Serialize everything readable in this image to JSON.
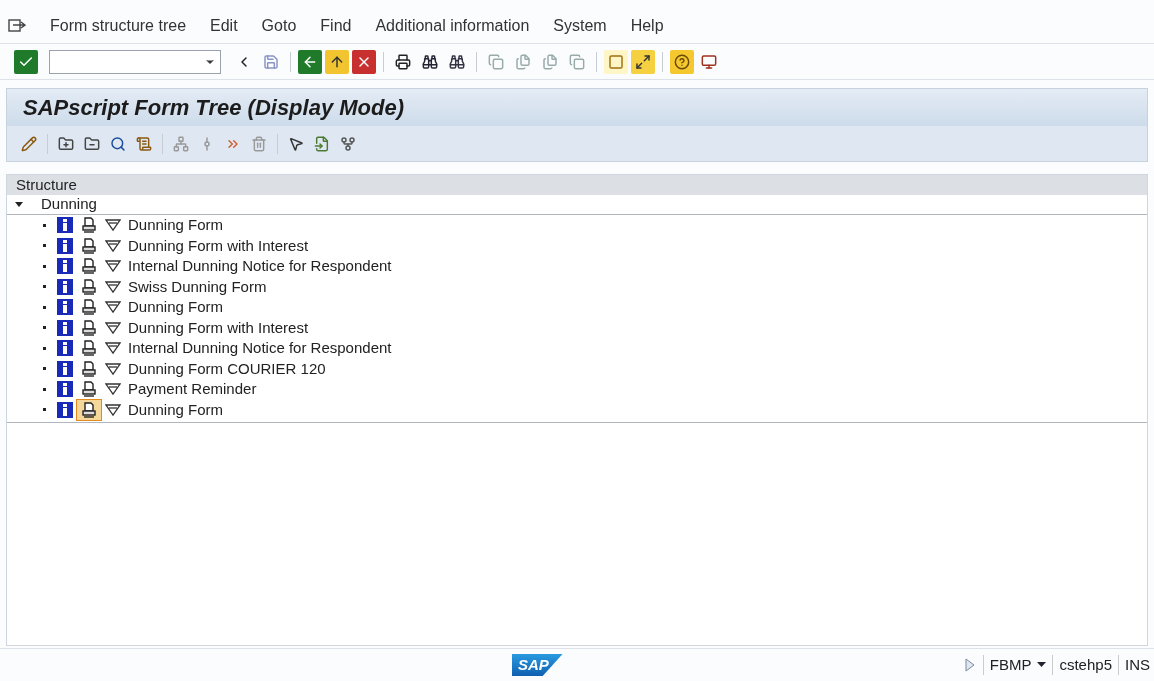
{
  "menu_bar": {
    "items": [
      "Form structure tree",
      "Edit",
      "Goto",
      "Find",
      "Additional information",
      "System",
      "Help"
    ]
  },
  "title": "SAPscript Form Tree (Display Mode)",
  "tree": {
    "header": "Structure",
    "root": {
      "label": "Dunning",
      "expanded": true,
      "children": [
        {
          "label": "Dunning Form",
          "selected": false
        },
        {
          "label": "Dunning Form with Interest",
          "selected": false
        },
        {
          "label": "Internal Dunning Notice for Respondent",
          "selected": false
        },
        {
          "label": "Swiss Dunning Form",
          "selected": false
        },
        {
          "label": "Dunning Form",
          "selected": false
        },
        {
          "label": "Dunning Form with Interest",
          "selected": false
        },
        {
          "label": "Internal Dunning Notice for Respondent",
          "selected": false
        },
        {
          "label": "Dunning Form COURIER 120",
          "selected": false
        },
        {
          "label": "Payment Reminder",
          "selected": false
        },
        {
          "label": "Dunning Form",
          "selected": true
        }
      ]
    }
  },
  "status_bar": {
    "logo": "SAP",
    "transaction": "FBMP",
    "server": "cstehp5",
    "mode": "INS"
  }
}
